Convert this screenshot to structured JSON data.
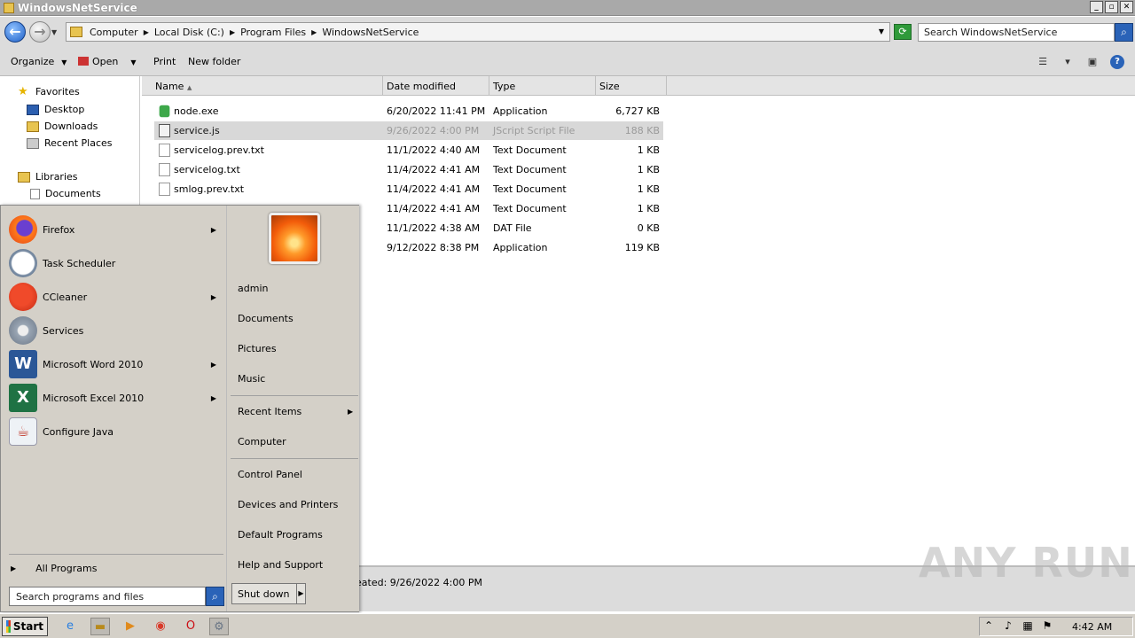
{
  "window": {
    "title": "WindowsNetService"
  },
  "address": {
    "crumbs": [
      "Computer",
      "Local Disk (C:)",
      "Program Files",
      "WindowsNetService"
    ],
    "search_placeholder": "Search WindowsNetService"
  },
  "toolbar": {
    "organize": "Organize",
    "open": "Open",
    "print": "Print",
    "new_folder": "New folder"
  },
  "navpane": {
    "favorites": "Favorites",
    "desktop": "Desktop",
    "downloads": "Downloads",
    "recent_places": "Recent Places",
    "libraries": "Libraries",
    "documents": "Documents"
  },
  "columns": {
    "name": "Name",
    "date": "Date modified",
    "type": "Type",
    "size": "Size"
  },
  "files": [
    {
      "name": "node.exe",
      "date": "6/20/2022 11:41 PM",
      "type": "Application",
      "size": "6,727 KB",
      "icon": "exe-icon"
    },
    {
      "name": "service.js",
      "date": "9/26/2022 4:00 PM",
      "type": "JScript Script File",
      "size": "188 KB",
      "icon": "script-icon"
    },
    {
      "name": "servicelog.prev.txt",
      "date": "11/1/2022 4:40 AM",
      "type": "Text Document",
      "size": "1 KB",
      "icon": "text-file-icon"
    },
    {
      "name": "servicelog.txt",
      "date": "11/4/2022 4:41 AM",
      "type": "Text Document",
      "size": "1 KB",
      "icon": "text-file-icon"
    },
    {
      "name": "smlog.prev.txt",
      "date": "11/4/2022 4:41 AM",
      "type": "Text Document",
      "size": "1 KB",
      "icon": "text-file-icon"
    },
    {
      "name": "",
      "date": "11/4/2022 4:41 AM",
      "type": "Text Document",
      "size": "1 KB",
      "icon": "text-file-icon"
    },
    {
      "name": "",
      "date": "11/1/2022 4:38 AM",
      "type": "DAT File",
      "size": "0 KB",
      "icon": "file-icon"
    },
    {
      "name": "",
      "date": "9/12/2022 8:38 PM",
      "type": "Application",
      "size": "119 KB",
      "icon": "exe-icon"
    }
  ],
  "details": {
    "text": "eated: 9/26/2022 4:00 PM"
  },
  "startmenu": {
    "programs": [
      "Firefox",
      "Task Scheduler",
      "CCleaner",
      "Services",
      "Microsoft Word 2010",
      "Microsoft Excel 2010",
      "Configure Java"
    ],
    "all_programs": "All Programs",
    "search_placeholder": "Search programs and files",
    "right": {
      "user": "admin",
      "documents": "Documents",
      "pictures": "Pictures",
      "music": "Music",
      "recent_items": "Recent Items",
      "computer": "Computer",
      "control_panel": "Control Panel",
      "devices_printers": "Devices and Printers",
      "default_programs": "Default Programs",
      "help_support": "Help and Support"
    },
    "shutdown": "Shut down"
  },
  "taskbar": {
    "start": "Start",
    "clock": "4:42 AM"
  },
  "watermark": "ANY RUN"
}
